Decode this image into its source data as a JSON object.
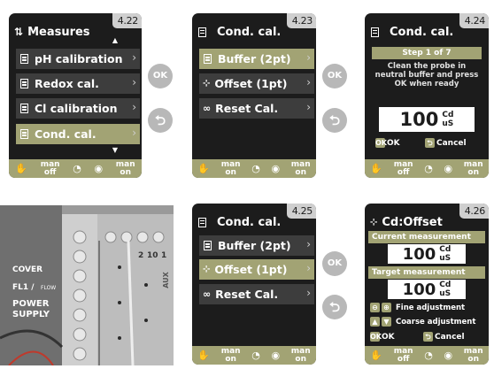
{
  "screens": {
    "s422": {
      "tag": "4.22",
      "title": "Measures",
      "items": [
        "pH calibration",
        "Redox cal.",
        "Cl calibration",
        "Cond. cal."
      ],
      "footer": [
        {
          "line1": "man",
          "line2": "off"
        },
        {
          "line1": "man",
          "line2": "on"
        }
      ]
    },
    "s423": {
      "tag": "4.23",
      "title": "Cond. cal.",
      "items": [
        "Buffer (2pt)",
        "Offset (1pt)",
        "Reset Cal."
      ],
      "footer": [
        {
          "line1": "man",
          "line2": "on"
        },
        {
          "line1": "man",
          "line2": "on"
        }
      ]
    },
    "s424": {
      "tag": "4.24",
      "title": "Cond. cal.",
      "step": "Step 1 of 7",
      "message": "Clean the probe in neutral buffer and press OK when ready",
      "value": "100",
      "unit1": "Cd",
      "unit2": "uS",
      "ok": "OK",
      "cancel": "Cancel",
      "footer": [
        {
          "line1": "man",
          "line2": "off"
        },
        {
          "line1": "man",
          "line2": "on"
        }
      ]
    },
    "s425": {
      "tag": "4.25",
      "title": "Cond. cal.",
      "items": [
        "Buffer (2pt)",
        "Offset (1pt)",
        "Reset Cal."
      ],
      "footer": [
        {
          "line1": "man",
          "line2": "on"
        },
        {
          "line1": "man",
          "line2": "on"
        }
      ]
    },
    "s426": {
      "tag": "4.26",
      "title": "Cd:Offset",
      "current_label": "Current measurement",
      "current_value": "100",
      "target_label": "Target measurement",
      "target_value": "100",
      "unit1": "Cd",
      "unit2": "uS",
      "fine": "Fine adjustment",
      "coarse": "Coarse adjustment",
      "ok": "OK",
      "cancel": "Cancel",
      "footer": [
        {
          "line1": "man",
          "line2": "off"
        },
        {
          "line1": "man",
          "line2": "on"
        }
      ]
    }
  },
  "buttons": {
    "ok": "OK",
    "back": "⮌"
  },
  "photo": {
    "labels": [
      "COVER",
      "FL1 /",
      "FLOW",
      "POWER",
      "SUPPLY",
      "AUX",
      "2",
      "10",
      "1"
    ]
  }
}
